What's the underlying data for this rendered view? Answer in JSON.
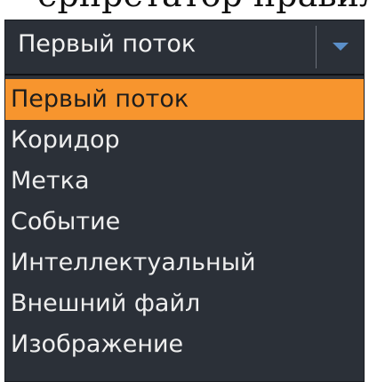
{
  "page": {
    "partial_heading": "ерпретатор правил для"
  },
  "combo": {
    "value": "Первый поток",
    "arrow_icon": "chevron-down-icon"
  },
  "list": {
    "items": [
      {
        "label": "Первый поток",
        "selected": true
      },
      {
        "label": "Коридор",
        "selected": false
      },
      {
        "label": "Метка",
        "selected": false
      },
      {
        "label": "Событие",
        "selected": false
      },
      {
        "label": "Интеллектуальный",
        "selected": false
      },
      {
        "label": "Внешний файл",
        "selected": false
      },
      {
        "label": "Изображение",
        "selected": false
      }
    ]
  },
  "colors": {
    "panel_bg": "#2b3038",
    "highlight": "#f7952e",
    "arrow": "#5b8fc9",
    "text_light": "#eeeeee",
    "text_dark": "#1d1d1d"
  }
}
